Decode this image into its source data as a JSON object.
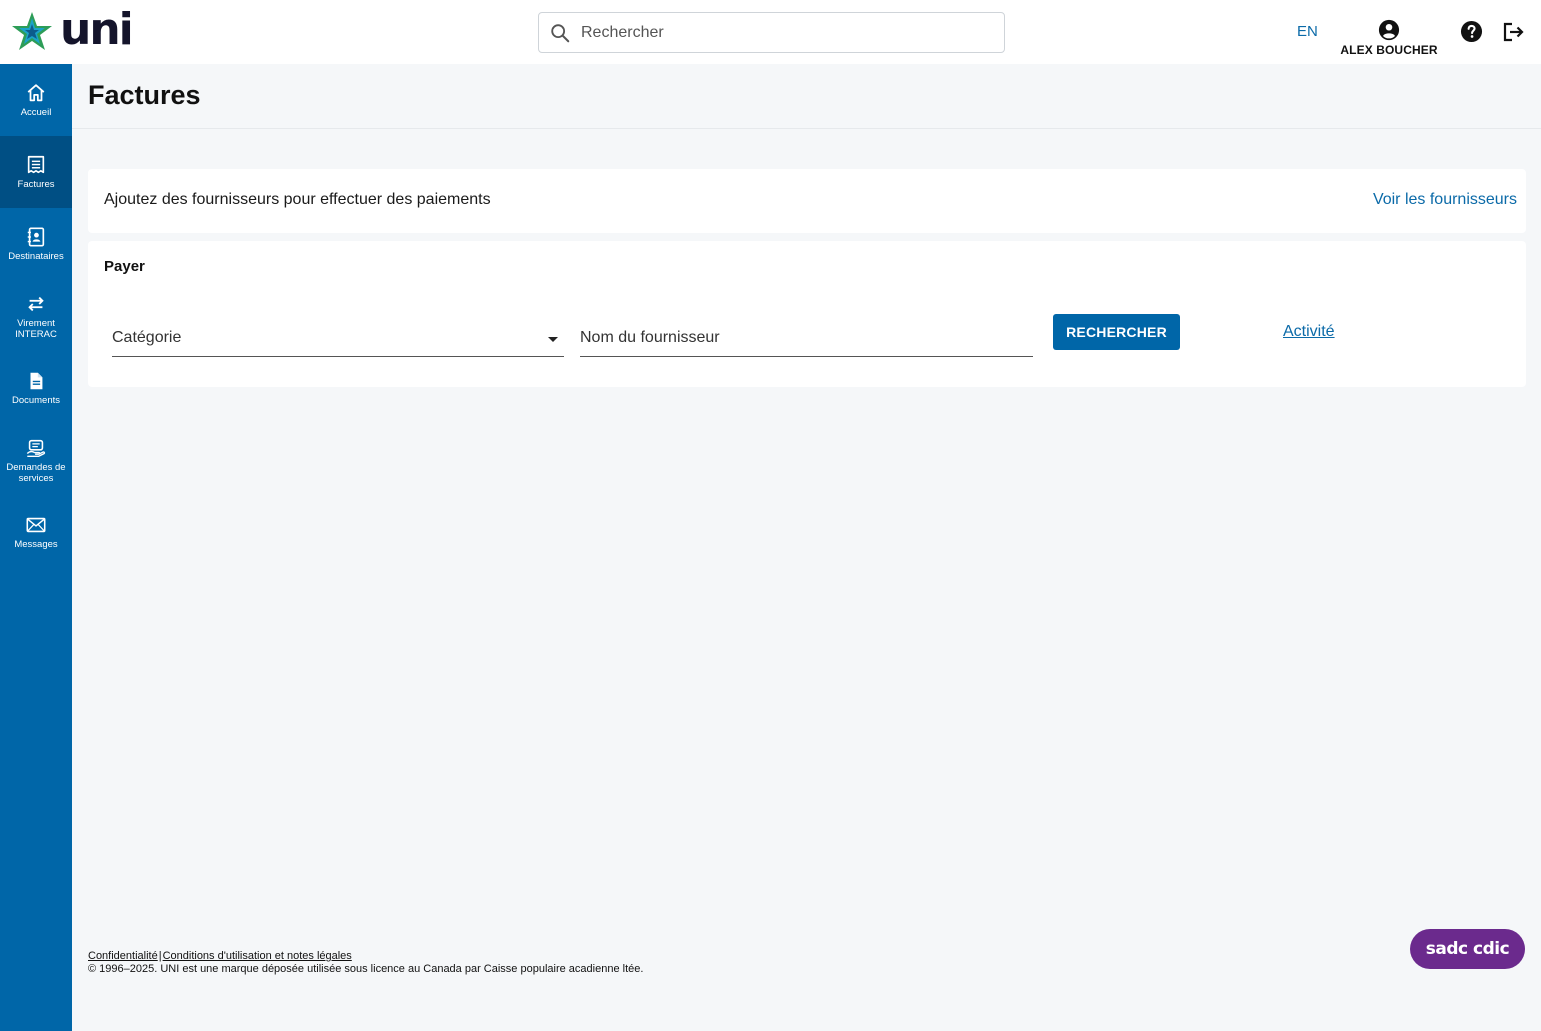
{
  "header": {
    "logo_text": "uni",
    "search_placeholder": "Rechercher",
    "lang": "EN",
    "user_name": "ALEX BOUCHER"
  },
  "sidebar": {
    "items": [
      {
        "label": "Accueil",
        "icon": "home-icon"
      },
      {
        "label": "Factures",
        "icon": "receipt-icon",
        "active": true
      },
      {
        "label": "Destinataires",
        "icon": "contacts-icon"
      },
      {
        "label": "Virement INTERAC",
        "icon": "transfer-icon"
      },
      {
        "label": "Documents",
        "icon": "document-icon"
      },
      {
        "label": "Demandes de services",
        "icon": "service-request-icon"
      },
      {
        "label": "Messages",
        "icon": "envelope-icon"
      }
    ]
  },
  "main": {
    "title": "Factures",
    "suppliers_card": {
      "message": "Ajoutez des fournisseurs pour effectuer des paiements",
      "link": "Voir les fournisseurs"
    },
    "pay_card": {
      "title": "Payer",
      "category_placeholder": "Catégorie",
      "supplier_placeholder": "Nom du fournisseur",
      "search_button": "RECHERCHER",
      "activity_link": "Activité"
    }
  },
  "footer": {
    "privacy": "Confidentialité",
    "separator": "|",
    "terms": "Conditions d'utilisation et notes légales",
    "copyright": "© 1996–2025. UNI est une marque déposée utilisée sous licence au Canada par Caisse populaire acadienne ltée.",
    "badge_text": "sadc cdic"
  },
  "colors": {
    "primary": "#0066a8",
    "sidebar_active": "#004f84",
    "link": "#0b6aa8",
    "background": "#f5f7f9",
    "cdic_badge": "#6b2a8d"
  }
}
